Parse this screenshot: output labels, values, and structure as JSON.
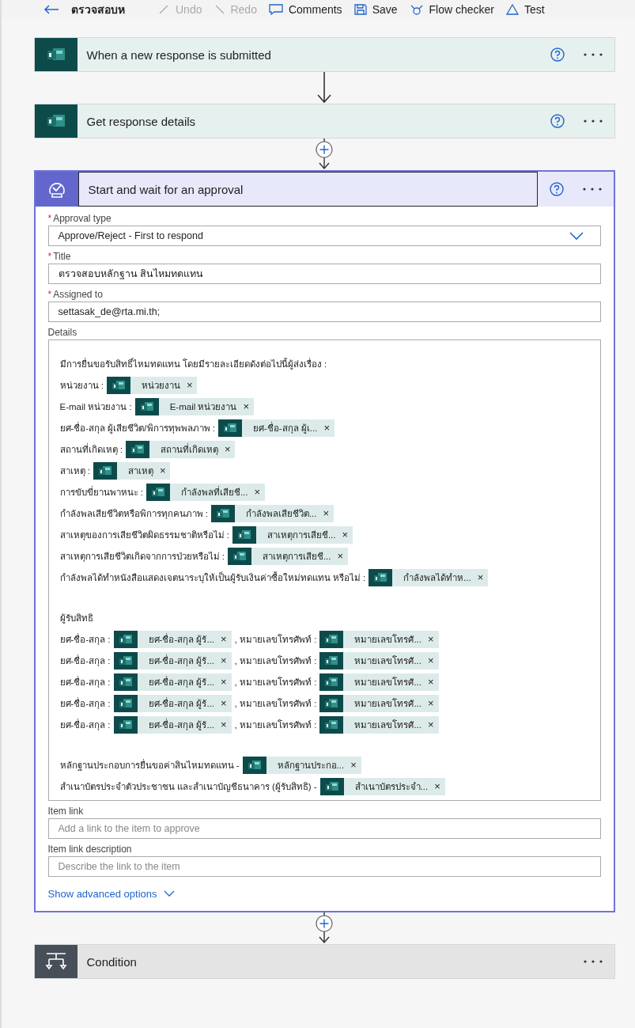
{
  "toolbar": {
    "flow_name": "ตรวจสอบห",
    "items": [
      {
        "label": "Undo",
        "disabled": true
      },
      {
        "label": "Redo",
        "disabled": true
      },
      {
        "label": "Comments",
        "disabled": false
      },
      {
        "label": "Save",
        "disabled": false
      },
      {
        "label": "Flow checker",
        "disabled": false
      },
      {
        "label": "Test",
        "disabled": false
      }
    ]
  },
  "steps": [
    {
      "kind": "forms",
      "title": "When a new response is submitted",
      "help": true,
      "selected": false,
      "connector": {
        "kind": "arrow"
      }
    },
    {
      "kind": "forms",
      "title": "Get response details",
      "help": true,
      "selected": false,
      "connector": {
        "kind": "plus"
      }
    },
    {
      "kind": "approval",
      "title": "Start and wait for an approval",
      "help": true,
      "selected": true,
      "connector": {
        "kind": "plus"
      },
      "fields": [
        {
          "kind": "dropdown",
          "label": "Approval type",
          "required_mark": "*",
          "value": "Approve/Reject - First to respond"
        },
        {
          "kind": "text",
          "label": "Title",
          "required_mark": "*",
          "value": "ตรวจสอบหลักฐาน สินไหมทดแทน"
        },
        {
          "kind": "text",
          "label": "Assigned to",
          "required_mark": "*",
          "value": "settasak_de@rta.mi.th;"
        },
        {
          "kind": "details",
          "label": "Details",
          "paragraphs": [
            [
              {
                "parts": [
                  {
                    "kind": "text",
                    "text": " มีการยื่นขอรับสิทธิ์ไหมทดแทน โดยมีรายละเอียดดังต่อไปนี้ผู้ส่งเรื่อง :"
                  }
                ]
              },
              {
                "parts": [
                  {
                    "kind": "text",
                    "text": "หน่วยงาน :"
                  },
                  {
                    "kind": "token",
                    "label": "หน่วยงาน",
                    "remove": "×"
                  }
                ]
              },
              {
                "parts": [
                  {
                    "kind": "text",
                    "text": "E-mail หน่วยงาน :"
                  },
                  {
                    "kind": "token",
                    "label": "E-mail หน่วยงาน",
                    "remove": "×"
                  }
                ]
              },
              {
                "parts": [
                  {
                    "kind": "text",
                    "text": "ยศ-ชื่อ-สกุล ผู้เสียชีวิต/พิการทุพพลภาพ :"
                  },
                  {
                    "kind": "token",
                    "label": "ยศ-ชื่อ-สกุล ผู้เ...",
                    "remove": "×"
                  }
                ]
              },
              {
                "parts": [
                  {
                    "kind": "text",
                    "text": "สถานที่เกิดเหตุ :"
                  },
                  {
                    "kind": "token",
                    "label": "สถานที่เกิดเหตุ",
                    "remove": "×"
                  }
                ]
              },
              {
                "parts": [
                  {
                    "kind": "text",
                    "text": "สาเหตุ :"
                  },
                  {
                    "kind": "token",
                    "label": "สาเหตุ",
                    "remove": "×"
                  }
                ]
              },
              {
                "parts": [
                  {
                    "kind": "text",
                    "text": "การขับขี่ยานพาหนะ :"
                  },
                  {
                    "kind": "token",
                    "label": "กำลังพลที่เสียชี...",
                    "remove": "×"
                  }
                ]
              },
              {
                "parts": [
                  {
                    "kind": "text",
                    "text": "กำลังพลเสียชีวิตหรือพิการทุกคนภาพ :"
                  },
                  {
                    "kind": "token",
                    "label": "กำลังพลเสียชีวิต...",
                    "remove": "×"
                  }
                ]
              },
              {
                "parts": [
                  {
                    "kind": "text",
                    "text": "สาเหตุของการเสียชีวิตผิดธรรมชาติหรือไม่ :"
                  },
                  {
                    "kind": "token",
                    "label": "สาเหตุการเสียชี...",
                    "remove": "×"
                  }
                ]
              },
              {
                "parts": [
                  {
                    "kind": "text",
                    "text": "สาเหตุการเสียชีวิตเกิดจากการป่วยหรือไม่ :"
                  },
                  {
                    "kind": "token",
                    "label": "สาเหตุการเสียชี...",
                    "remove": "×"
                  }
                ]
              },
              {
                "parts": [
                  {
                    "kind": "text",
                    "text": "กำลังพลได้ทำหนังสือแสดงเจตนาระบุให้เป็นผู้รับเงินค่าซื้อใหม่ทดแทน หรือไม่ :"
                  },
                  {
                    "kind": "token",
                    "label": "กำลังพลได้ทำห...",
                    "remove": "×"
                  }
                ]
              }
            ],
            [
              {
                "parts": [
                  {
                    "kind": "text",
                    "text": "ผู้รับสิทธิ"
                  }
                ]
              },
              {
                "parts": [
                  {
                    "kind": "text",
                    "text": "ยศ-ชื่อ-สกุล :"
                  },
                  {
                    "kind": "token",
                    "label": "ยศ-ชื่อ-สกุล ผู้รั...",
                    "remove": "×"
                  },
                  {
                    "kind": "text",
                    "text": ", หมายเลขโทรศัพท์ :"
                  },
                  {
                    "kind": "token",
                    "label": "หมายเลขโทรศั...",
                    "remove": "×"
                  }
                ]
              },
              {
                "parts": [
                  {
                    "kind": "text",
                    "text": "ยศ-ชื่อ-สกุล :"
                  },
                  {
                    "kind": "token",
                    "label": "ยศ-ชื่อ-สกุล ผู้รั...",
                    "remove": "×"
                  },
                  {
                    "kind": "text",
                    "text": ", หมายเลขโทรศัพท์ :"
                  },
                  {
                    "kind": "token",
                    "label": "หมายเลขโทรศั...",
                    "remove": "×"
                  }
                ]
              },
              {
                "parts": [
                  {
                    "kind": "text",
                    "text": "ยศ-ชื่อ-สกุล :"
                  },
                  {
                    "kind": "token",
                    "label": "ยศ-ชื่อ-สกุล ผู้รั...",
                    "remove": "×"
                  },
                  {
                    "kind": "text",
                    "text": ", หมายเลขโทรศัพท์ :"
                  },
                  {
                    "kind": "token",
                    "label": "หมายเลขโทรศั...",
                    "remove": "×"
                  }
                ]
              },
              {
                "parts": [
                  {
                    "kind": "text",
                    "text": "ยศ-ชื่อ-สกุล :"
                  },
                  {
                    "kind": "token",
                    "label": "ยศ-ชื่อ-สกุล ผู้รั...",
                    "remove": "×"
                  },
                  {
                    "kind": "text",
                    "text": ", หมายเลขโทรศัพท์ :"
                  },
                  {
                    "kind": "token",
                    "label": "หมายเลขโทรศั...",
                    "remove": "×"
                  }
                ]
              },
              {
                "parts": [
                  {
                    "kind": "text",
                    "text": "ยศ-ชื่อ-สกุล :"
                  },
                  {
                    "kind": "token",
                    "label": "ยศ-ชื่อ-สกุล ผู้รั...",
                    "remove": "×"
                  },
                  {
                    "kind": "text",
                    "text": ", หมายเลขโทรศัพท์ :"
                  },
                  {
                    "kind": "token",
                    "label": "หมายเลขโทรศั...",
                    "remove": "×"
                  }
                ]
              }
            ],
            [
              {
                "parts": [
                  {
                    "kind": "text",
                    "text": "หลักฐานประกอบการยื่นขอค่าสินไหมทดแทน -"
                  },
                  {
                    "kind": "token",
                    "label": "หลักฐานประกอ...",
                    "remove": "×"
                  }
                ]
              },
              {
                "parts": [
                  {
                    "kind": "text",
                    "text": "สำเนาบัตรประจำตัวประชาชน และสำเนาบัญชีธนาคาร (ผู้รับสิทธิ) -"
                  },
                  {
                    "kind": "token",
                    "label": "สำเนาบัตรประจำ...",
                    "remove": "×"
                  }
                ]
              }
            ]
          ]
        },
        {
          "kind": "text",
          "label": "Item link",
          "placeholder": "Add a link to the item to approve"
        },
        {
          "kind": "text",
          "label": "Item link description",
          "placeholder": "Describe the link to the item"
        }
      ],
      "advanced": "Show advanced options"
    },
    {
      "kind": "condition",
      "title": "Condition",
      "help": false,
      "selected": false
    }
  ]
}
